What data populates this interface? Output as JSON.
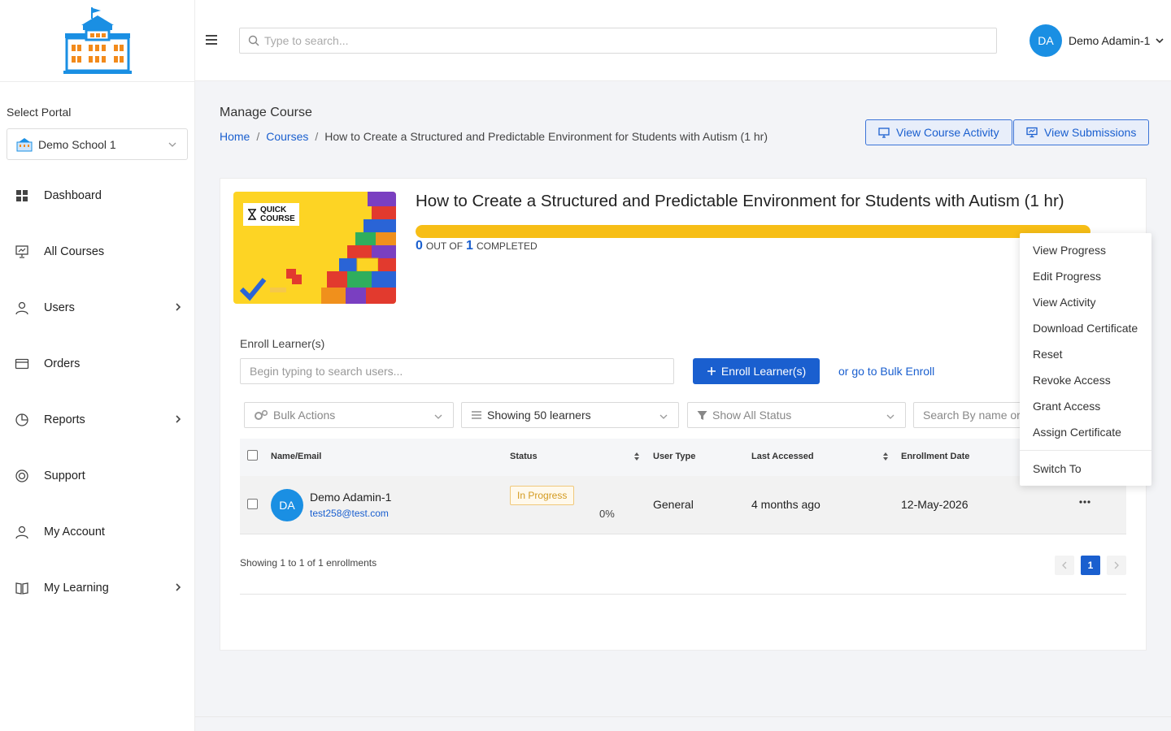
{
  "colors": {
    "accent": "#1a5fcf",
    "avatar": "#1a8fe3",
    "progress": "#f7be16",
    "status_in_progress": "#d39a1f"
  },
  "sidebar": {
    "portal_label": "Select Portal",
    "portal_value": "Demo School 1",
    "items": [
      {
        "label": "Dashboard",
        "icon": "grid-icon"
      },
      {
        "label": "All Courses",
        "icon": "presentation-icon"
      },
      {
        "label": "Users",
        "icon": "user-icon"
      },
      {
        "label": "Orders",
        "icon": "card-icon"
      },
      {
        "label": "Reports",
        "icon": "pie-chart-icon"
      },
      {
        "label": "Support",
        "icon": "lifebuoy-icon"
      },
      {
        "label": "My Account",
        "icon": "user-icon"
      },
      {
        "label": "My Learning",
        "icon": "book-icon"
      }
    ]
  },
  "header": {
    "search_placeholder": "Type to search...",
    "user_initials": "DA",
    "user_name": "Demo Adamin-1"
  },
  "page": {
    "title": "Manage Course",
    "breadcrumb": [
      "Home",
      "Courses",
      "How to Create a Structured and Predictable Environment for Students with Autism (1 hr)"
    ],
    "view_activity_label": "View Course Activity",
    "view_submissions_label": "View Submissions"
  },
  "course": {
    "badge_line1": "QUICK",
    "badge_line2": "COURSE",
    "title": "How to Create a Structured and Predictable Environment for Students with Autism (1 hr)",
    "completed_count": "0",
    "out_of_text": "OUT OF",
    "total_count": "1",
    "completed_text": "COMPLETED",
    "progress_fraction": 1.0
  },
  "enroll": {
    "label": "Enroll Learner(s)",
    "placeholder": "Begin typing to search users...",
    "button_label": "Enroll Learner(s)",
    "bulk_link": "or go to Bulk Enroll"
  },
  "filters": {
    "bulk_actions": "Bulk Actions",
    "showing": "Showing 50 learners",
    "status": "Show All Status",
    "search_placeholder": "Search By name or"
  },
  "table": {
    "headers": [
      "Name/Email",
      "Status",
      "User Type",
      "Last Accessed",
      "Enrollment Date"
    ],
    "rows": [
      {
        "initials": "DA",
        "name": "Demo Adamin-1",
        "email": "test258@test.com",
        "status": "In Progress",
        "percent": "0%",
        "user_type": "General",
        "last_accessed": "4 months ago",
        "enrollment_date": "12-May-2026"
      }
    ],
    "footer": "Showing 1 to 1 of 1 enrollments",
    "current_page": "1"
  },
  "context_menu": {
    "items": [
      "View Progress",
      "Edit Progress",
      "View Activity",
      "Download Certificate",
      "Reset",
      "Revoke Access",
      "Grant Access",
      "Assign Certificate"
    ],
    "footer_item": "Switch To"
  }
}
